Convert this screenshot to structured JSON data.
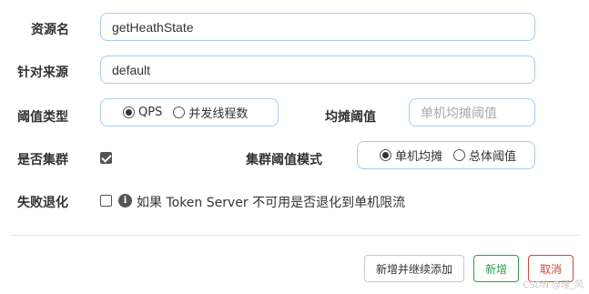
{
  "form": {
    "resource_name": {
      "label": "资源名",
      "value": "getHeathState"
    },
    "limit_app": {
      "label": "针对来源",
      "value": "default"
    },
    "threshold_type": {
      "label": "阈值类型",
      "options": [
        "QPS",
        "并发线程数"
      ],
      "selected": "QPS"
    },
    "avg_threshold": {
      "label": "均摊阈值",
      "placeholder": "单机均摊阈值"
    },
    "cluster": {
      "label": "是否集群",
      "checked": true
    },
    "cluster_threshold_mode": {
      "label": "集群阈值模式",
      "options": [
        "单机均摊",
        "总体阈值"
      ],
      "selected": "单机均摊"
    },
    "fallback": {
      "label": "失败退化",
      "checked": false,
      "info_icon": "info-icon",
      "hint": "如果 Token Server 不可用是否退化到单机限流"
    }
  },
  "footer": {
    "add_continue_label": "新增并继续添加",
    "add_label": "新增",
    "cancel_label": "取消"
  },
  "watermark": "CSDN @瑾_风",
  "colors": {
    "input_border": "#aac8ee",
    "success": "#2e9e4a",
    "danger": "#d9433b"
  }
}
